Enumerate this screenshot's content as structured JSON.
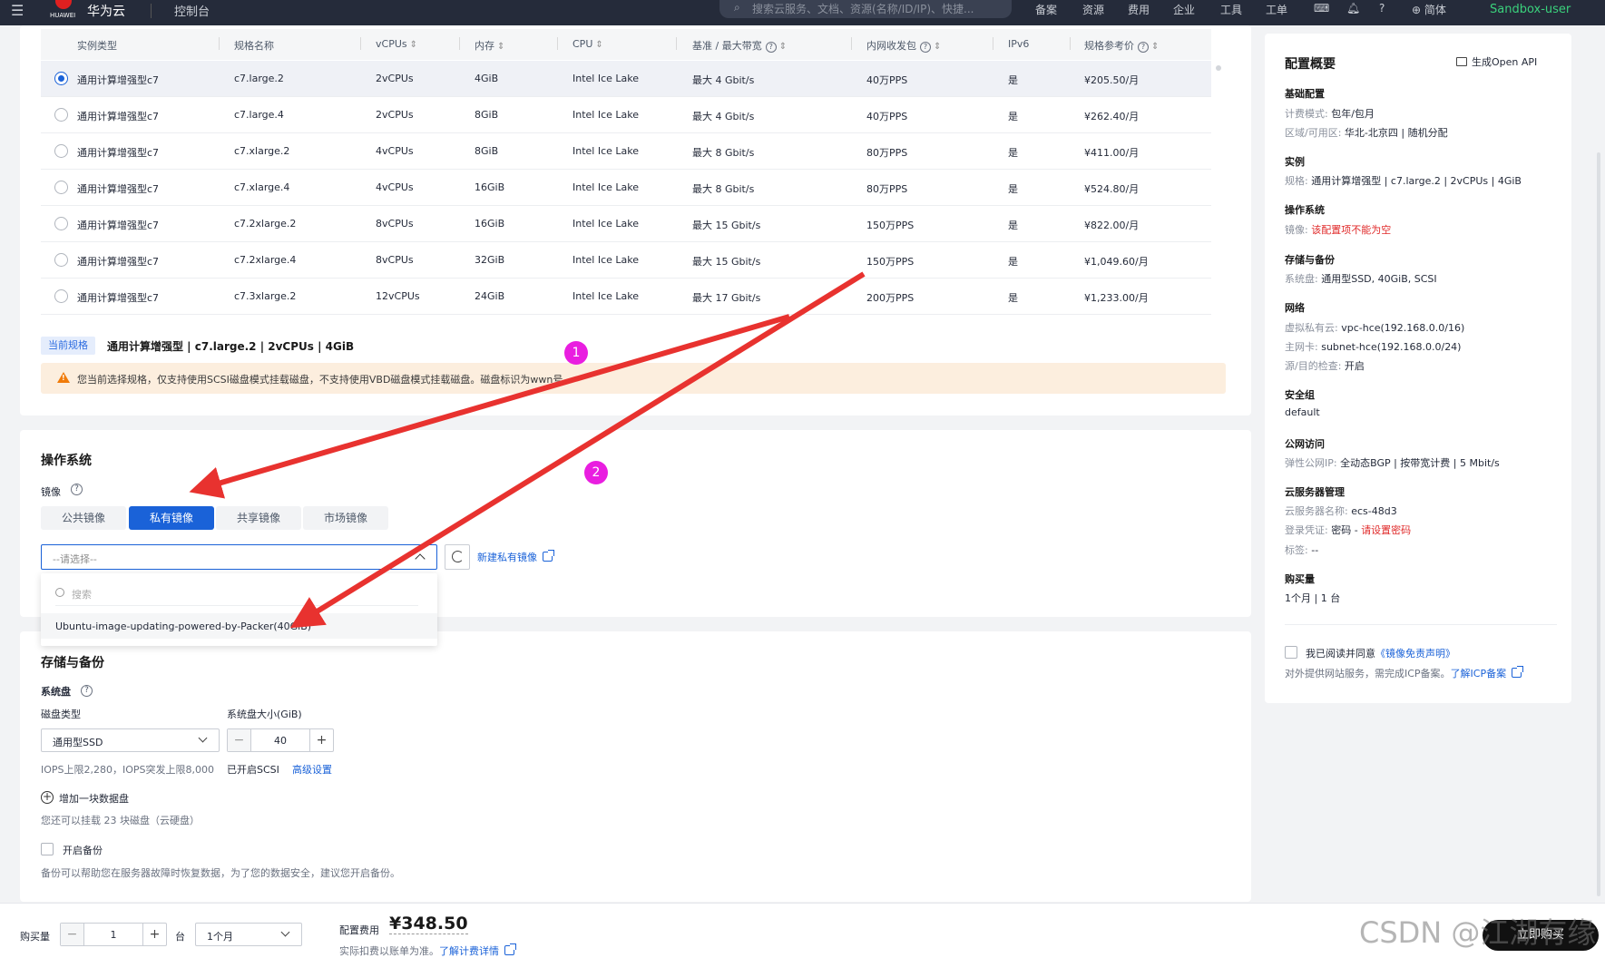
{
  "topnav": {
    "brand": "华为云",
    "logo_text": "HUAWEI",
    "console": "控制台",
    "search_placeholder": "搜索云服务、文档、资源(名称/ID/IP)、快捷...",
    "items": [
      "备案",
      "资源",
      "费用",
      "企业",
      "工具",
      "工单"
    ],
    "lang": "简体",
    "user": "Sandbox-user"
  },
  "spec_table": {
    "headers": [
      "实例类型",
      "规格名称",
      "vCPUs",
      "内存",
      "CPU",
      "基准 / 最大带宽",
      "内网收发包",
      "IPv6",
      "规格参考价"
    ],
    "rows": [
      {
        "type": "通用计算增强型c7",
        "name": "c7.large.2",
        "vcpus": "2vCPUs",
        "mem": "4GiB",
        "cpu": "Intel Ice Lake",
        "bw": "最大 4 Gbit/s",
        "pps": "40万PPS",
        "ipv6": "是",
        "price": "¥205.50/月",
        "selected": true
      },
      {
        "type": "通用计算增强型c7",
        "name": "c7.large.4",
        "vcpus": "2vCPUs",
        "mem": "8GiB",
        "cpu": "Intel Ice Lake",
        "bw": "最大 4 Gbit/s",
        "pps": "40万PPS",
        "ipv6": "是",
        "price": "¥262.40/月",
        "selected": false
      },
      {
        "type": "通用计算增强型c7",
        "name": "c7.xlarge.2",
        "vcpus": "4vCPUs",
        "mem": "8GiB",
        "cpu": "Intel Ice Lake",
        "bw": "最大 8 Gbit/s",
        "pps": "80万PPS",
        "ipv6": "是",
        "price": "¥411.00/月",
        "selected": false
      },
      {
        "type": "通用计算增强型c7",
        "name": "c7.xlarge.4",
        "vcpus": "4vCPUs",
        "mem": "16GiB",
        "cpu": "Intel Ice Lake",
        "bw": "最大 8 Gbit/s",
        "pps": "80万PPS",
        "ipv6": "是",
        "price": "¥524.80/月",
        "selected": false
      },
      {
        "type": "通用计算增强型c7",
        "name": "c7.2xlarge.2",
        "vcpus": "8vCPUs",
        "mem": "16GiB",
        "cpu": "Intel Ice Lake",
        "bw": "最大 15 Gbit/s",
        "pps": "150万PPS",
        "ipv6": "是",
        "price": "¥822.00/月",
        "selected": false
      },
      {
        "type": "通用计算增强型c7",
        "name": "c7.2xlarge.4",
        "vcpus": "8vCPUs",
        "mem": "32GiB",
        "cpu": "Intel Ice Lake",
        "bw": "最大 15 Gbit/s",
        "pps": "150万PPS",
        "ipv6": "是",
        "price": "¥1,049.60/月",
        "selected": false
      },
      {
        "type": "通用计算增强型c7",
        "name": "c7.3xlarge.2",
        "vcpus": "12vCPUs",
        "mem": "24GiB",
        "cpu": "Intel Ice Lake",
        "bw": "最大 17 Gbit/s",
        "pps": "200万PPS",
        "ipv6": "是",
        "price": "¥1,233.00/月",
        "selected": false
      }
    ]
  },
  "current_spec": {
    "tag": "当前规格",
    "value": "通用计算增强型 | c7.large.2 | 2vCPUs | 4GiB",
    "warning": "您当前选择规格，仅支持使用SCSI磁盘模式挂载磁盘，不支持使用VBD磁盘模式挂载磁盘。磁盘标识为wwn号。"
  },
  "os": {
    "title": "操作系统",
    "image_label": "镜像",
    "tabs": [
      "公共镜像",
      "私有镜像",
      "共享镜像",
      "市场镜像"
    ],
    "active_tab": "私有镜像",
    "select_placeholder": "--请选择--",
    "new_private_image": "新建私有镜像",
    "dropdown_search_placeholder": "搜索",
    "dropdown_option": "Ubuntu-image-updating-powered-by-Packer(40GiB)"
  },
  "storage": {
    "title": "存储与备份",
    "system_disk": "系统盘",
    "disk_type_label": "磁盘类型",
    "disk_size_label": "系统盘大小(GiB)",
    "disk_type_value": "通用型SSD",
    "disk_size_value": "40",
    "iops": "IOPS上限2,280，IOPS突发上限8,000",
    "scsi": "已开启SCSI",
    "advanced": "高级设置",
    "add_data_disk": "增加一块数据盘",
    "mount_hint": "您还可以挂载 23 块磁盘（云硬盘）",
    "enable_backup": "开启备份",
    "backup_hint": "备份可以帮助您在服务器故障时恢复数据，为了您的数据安全，建议您开启备份。"
  },
  "summary": {
    "title": "配置概要",
    "open_api": "生成Open API",
    "basic_title": "基础配置",
    "billing_k": "计费模式:",
    "billing_v": "包年/包月",
    "region_k": "区域/可用区:",
    "region_v": "华北-北京四 | 随机分配",
    "instance_title": "实例",
    "spec_k": "规格:",
    "spec_v": "通用计算增强型 | c7.large.2 | 2vCPUs | 4GiB",
    "os_title": "操作系统",
    "image_k": "镜像:",
    "image_v": "该配置项不能为空",
    "storage_title": "存储与备份",
    "sysdisk_k": "系统盘:",
    "sysdisk_v": "通用型SSD, 40GiB, SCSI",
    "network_title": "网络",
    "vpc_k": "虚拟私有云:",
    "vpc_v": "vpc-hce(192.168.0.0/16)",
    "nic_k": "主网卡:",
    "nic_v": "subnet-hce(192.168.0.0/24)",
    "srcdst_k": "源/目的检查:",
    "srcdst_v": "开启",
    "sg_title": "安全组",
    "sg_v": "default",
    "public_title": "公网访问",
    "eip_k": "弹性公网IP:",
    "eip_v": "全动态BGP | 按带宽计费 | 5 Mbit/s",
    "mgmt_title": "云服务器管理",
    "srvname_k": "云服务器名称:",
    "srvname_v": "ecs-48d3",
    "login_k": "登录凭证:",
    "login_v": "密码 -",
    "login_link": "请设置密码",
    "tag_k": "标签:",
    "tag_v": "--",
    "qty_title": "购买量",
    "qty_v": "1个月 | 1 台",
    "agree_pre": "我已阅读并同意",
    "agree_link": "《镜像免责声明》",
    "icp_pre": "对外提供网站服务，需完成ICP备案。",
    "icp_link": "了解ICP备案"
  },
  "bottom": {
    "qty_label": "购买量",
    "qty_value": "1",
    "unit": "台",
    "duration": "1个月",
    "price_label": "配置费用",
    "price": "¥348.50",
    "price_note": "实际扣费以账单为准。",
    "price_link": "了解计费详情",
    "buy_button": "立即购买",
    "watermark": "CSDN @江湖有缘"
  },
  "annotations": [
    "1",
    "2"
  ],
  "colors": {
    "accent": "#1a62d8",
    "annotation": "#e91ee0",
    "arrow": "#e8322f",
    "warning_bg": "#fceede"
  }
}
